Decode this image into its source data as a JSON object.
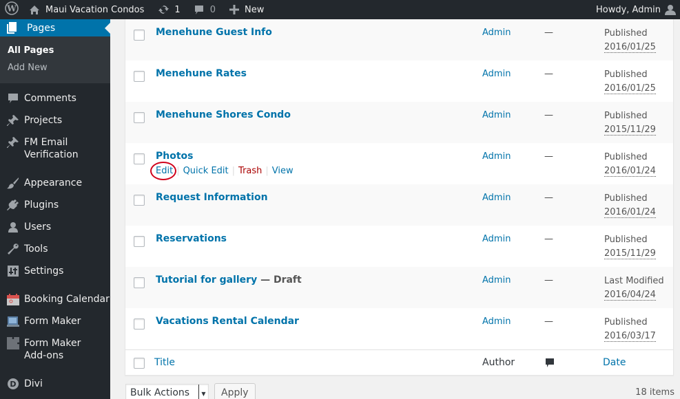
{
  "adminbar": {
    "site_name": "Maui Vacation Condos",
    "updates_count": "1",
    "comments_count": "0",
    "new_label": "New",
    "greeting": "Howdy, Admin"
  },
  "sidebar": {
    "current": {
      "label": "Pages",
      "icon": "pages-icon"
    },
    "submenu": [
      {
        "label": "All Pages",
        "current": true
      },
      {
        "label": "Add New",
        "current": false
      }
    ],
    "items": [
      {
        "label": "Comments",
        "icon": "comment-icon"
      },
      {
        "label": "Projects",
        "icon": "pin-icon"
      },
      {
        "label": "FM Email Verification",
        "icon": "pin-icon"
      },
      {
        "label": "Appearance",
        "icon": "paintbrush-icon"
      },
      {
        "label": "Plugins",
        "icon": "plugin-icon"
      },
      {
        "label": "Users",
        "icon": "user-icon"
      },
      {
        "label": "Tools",
        "icon": "wrench-icon"
      },
      {
        "label": "Settings",
        "icon": "sliders-icon"
      },
      {
        "label": "Booking Calendar",
        "icon": "calendar-icon"
      },
      {
        "label": "Form Maker",
        "icon": "form-icon"
      },
      {
        "label": "Form Maker Add-ons",
        "icon": "puzzle-icon"
      },
      {
        "label": "Divi",
        "icon": "divi-icon"
      }
    ]
  },
  "table": {
    "rows": [
      {
        "title": "Menehune Guest Info",
        "state": "",
        "author": "Admin",
        "comments": "—",
        "status": "Published",
        "date": "2016/01/25"
      },
      {
        "title": "Menehune Rates",
        "state": "",
        "author": "Admin",
        "comments": "—",
        "status": "Published",
        "date": "2016/01/25"
      },
      {
        "title": "Menehune Shores Condo",
        "state": "",
        "author": "Admin",
        "comments": "—",
        "status": "Published",
        "date": "2015/11/29"
      },
      {
        "title": "Photos",
        "state": "",
        "author": "Admin",
        "comments": "—",
        "status": "Published",
        "date": "2016/01/24"
      },
      {
        "title": "Request Information",
        "state": "",
        "author": "Admin",
        "comments": "—",
        "status": "Published",
        "date": "2016/01/24"
      },
      {
        "title": "Reservations",
        "state": "",
        "author": "Admin",
        "comments": "—",
        "status": "Published",
        "date": "2015/11/29"
      },
      {
        "title": "Tutorial for gallery",
        "state": " — Draft",
        "author": "Admin",
        "comments": "—",
        "status": "Last Modified",
        "date": "2016/04/24"
      },
      {
        "title": "Vacations Rental Calendar",
        "state": "",
        "author": "Admin",
        "comments": "—",
        "status": "Published",
        "date": "2016/03/17"
      }
    ],
    "row_actions": {
      "edit": "Edit",
      "quick_edit": "Quick Edit",
      "trash": "Trash",
      "view": "View"
    },
    "footer": {
      "title": "Title",
      "author": "Author",
      "date": "Date"
    }
  },
  "bottom": {
    "bulk_actions": "Bulk Actions",
    "apply": "Apply",
    "items_count": "18 items"
  }
}
